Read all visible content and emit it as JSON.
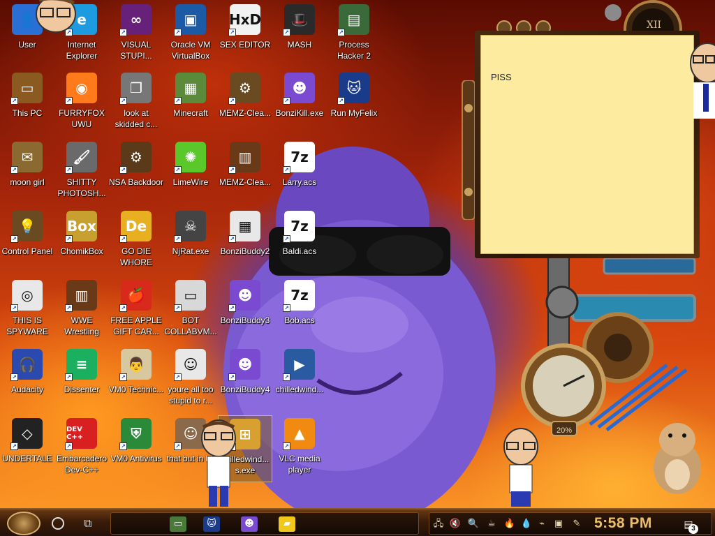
{
  "desktop": {
    "icons": [
      {
        "label": "User",
        "icon": "user-folder-icon",
        "color": "#2a6fd6",
        "glyph": "👤"
      },
      {
        "label": "Internet Explorer",
        "icon": "internet-explorer-icon",
        "color": "#1d9be0",
        "glyph": "e"
      },
      {
        "label": "VISUAL STUPI...",
        "icon": "visual-studio-icon",
        "color": "#68217a",
        "glyph": "∞"
      },
      {
        "label": "Oracle VM VirtualBox",
        "icon": "virtualbox-icon",
        "color": "#1c5aa6",
        "glyph": "▣"
      },
      {
        "label": "SEX EDITOR",
        "icon": "hex-editor-icon",
        "color": "#f2f2f2",
        "glyph": "HxD"
      },
      {
        "label": "MASH",
        "icon": "mash-hat-icon",
        "color": "#2a2a2a",
        "glyph": "🎩"
      },
      {
        "label": "Process Hacker 2",
        "icon": "process-hacker-icon",
        "color": "#3a6a3a",
        "glyph": "▤"
      },
      {
        "label": "This PC",
        "icon": "this-pc-icon",
        "color": "#8a5a20",
        "glyph": "▭"
      },
      {
        "label": "FURRYFOX UWU",
        "icon": "firefox-icon",
        "color": "#ff7a1a",
        "glyph": "◉"
      },
      {
        "label": "look at skidded c...",
        "icon": "copy-files-icon",
        "color": "#777777",
        "glyph": "❐"
      },
      {
        "label": "Minecraft",
        "icon": "minecraft-icon",
        "color": "#5a8a3a",
        "glyph": "▦"
      },
      {
        "label": "MEMZ-Clea...",
        "icon": "memz-gear-icon",
        "color": "#6a4a20",
        "glyph": "⚙"
      },
      {
        "label": "BonziKill.exe",
        "icon": "bonzi-icon",
        "color": "#7a4ad0",
        "glyph": "☻"
      },
      {
        "label": "Run MyFelix",
        "icon": "cat-icon",
        "color": "#1a3a8a",
        "glyph": "🐱"
      },
      {
        "label": "moon girl",
        "icon": "scroll-icon",
        "color": "#8a6a30",
        "glyph": "✉"
      },
      {
        "label": "SHITTY PHOTOSH...",
        "icon": "gimp-icon",
        "color": "#6a6a6a",
        "glyph": "🖌"
      },
      {
        "label": "NSA Backdoor",
        "icon": "gear-frame-icon",
        "color": "#5a3a18",
        "glyph": "⚙"
      },
      {
        "label": "LimeWire",
        "icon": "limewire-icon",
        "color": "#5ac82a",
        "glyph": "✺"
      },
      {
        "label": "MEMZ-Clea...",
        "icon": "memz-frame-icon",
        "color": "#6a3a18",
        "glyph": "▥"
      },
      {
        "label": "Larry.acs",
        "icon": "7zip-icon",
        "color": "#ffffff",
        "glyph": "7z"
      },
      {
        "label": "Control Panel",
        "icon": "control-panel-icon",
        "color": "#6a4a20",
        "glyph": "💡"
      },
      {
        "label": "ChomikBox",
        "icon": "chomikbox-icon",
        "color": "#c8a030",
        "glyph": "Box"
      },
      {
        "label": "GO DIE WHORE",
        "icon": "de-icon",
        "color": "#e8b020",
        "glyph": "De"
      },
      {
        "label": "NjRat.exe",
        "icon": "skull-icon",
        "color": "#444444",
        "glyph": "☠"
      },
      {
        "label": "BonziBuddy2",
        "icon": "bonzi-window-icon",
        "color": "#e8e8e8",
        "glyph": "▦"
      },
      {
        "label": "Baldi.acs",
        "icon": "7zip-icon",
        "color": "#ffffff",
        "glyph": "7z"
      },
      {
        "label": "THIS IS SPYWARE",
        "icon": "chrome-icon",
        "color": "#e8e8e8",
        "glyph": "◎"
      },
      {
        "label": "WWE Wrestling",
        "icon": "wrestling-frame-icon",
        "color": "#6a3a18",
        "glyph": "▥"
      },
      {
        "label": "FREE APPLE GIFT CAR...",
        "icon": "apple-icon",
        "color": "#d82a1a",
        "glyph": "🍎"
      },
      {
        "label": "BOT COLLABVM...",
        "icon": "monitor-icon",
        "color": "#d8d8d8",
        "glyph": "▭"
      },
      {
        "label": "BonziBuddy3",
        "icon": "bonzi-icon",
        "color": "#7a4ad0",
        "glyph": "☻"
      },
      {
        "label": "Bob.acs",
        "icon": "7zip-icon",
        "color": "#ffffff",
        "glyph": "7z"
      },
      {
        "label": "Audacity",
        "icon": "audacity-icon",
        "color": "#2a4ab0",
        "glyph": "🎧"
      },
      {
        "label": "Dissenter",
        "icon": "dissenter-icon",
        "color": "#1ab060",
        "glyph": "≡"
      },
      {
        "label": "VM0 Technic...",
        "icon": "technician-icon",
        "color": "#d8c8a0",
        "glyph": "👨"
      },
      {
        "label": "youre all too stupid to r...",
        "icon": "portrait-icon",
        "color": "#e8e8e8",
        "glyph": "☺"
      },
      {
        "label": "BonziBuddy4",
        "icon": "bonzi-icon",
        "color": "#7a4ad0",
        "glyph": "☻"
      },
      {
        "label": "chilledwind...",
        "icon": "video-file-icon",
        "color": "#2a5aa0",
        "glyph": "▶"
      },
      {
        "label": "UNDERTALE",
        "icon": "unity-icon",
        "color": "#222222",
        "glyph": "◇"
      },
      {
        "label": "Embarcadero Dev-C++",
        "icon": "devcpp-icon",
        "color": "#d82020",
        "glyph": "DEV C++"
      },
      {
        "label": "VM0 Antivirus",
        "icon": "shield-icon",
        "color": "#2a8a3a",
        "glyph": "⛨"
      },
      {
        "label": "that but in bit",
        "icon": "painting-icon",
        "color": "#8a6a4a",
        "glyph": "☺"
      },
      {
        "label": "chilledwind... s.exe",
        "icon": "windows-xp-icon",
        "color": "#d8a030",
        "glyph": "⊞"
      },
      {
        "label": "VLC media player",
        "icon": "vlc-icon",
        "color": "#f08a10",
        "glyph": "▲"
      }
    ]
  },
  "sticky_note": {
    "text": "PISS"
  },
  "taskbar": {
    "apps": [
      {
        "icon": "this-pc-taskbar-icon",
        "color": "#4a7a3a",
        "glyph": "▭"
      },
      {
        "icon": "felix-cat-taskbar-icon",
        "color": "#1a3a8a",
        "glyph": "🐱"
      },
      {
        "icon": "bonzi-taskbar-icon",
        "color": "#7a4ad0",
        "glyph": "☻"
      },
      {
        "icon": "sticky-notes-taskbar-icon",
        "color": "#f0c81a",
        "glyph": "▰"
      }
    ],
    "tray": [
      {
        "icon": "network-icon",
        "glyph": "🖧"
      },
      {
        "icon": "volume-muted-icon",
        "glyph": "🔇"
      },
      {
        "icon": "search-tray-icon",
        "glyph": "🔍"
      },
      {
        "icon": "java-icon",
        "glyph": "☕"
      },
      {
        "icon": "flame-tray-icon",
        "glyph": "🔥"
      },
      {
        "icon": "droplet-icon",
        "glyph": "💧"
      },
      {
        "icon": "wifi-off-icon",
        "glyph": "⌁"
      },
      {
        "icon": "app-tray-icon",
        "glyph": "▣"
      },
      {
        "icon": "pen-tray-icon",
        "glyph": "✎"
      }
    ],
    "clock": "5:58 PM",
    "notification_count": "3"
  },
  "widget": {
    "gauge_percent": "20%"
  }
}
